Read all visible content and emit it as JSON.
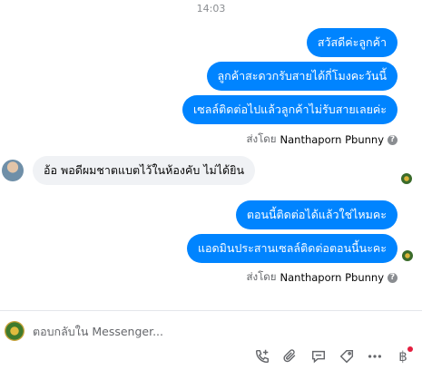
{
  "conversation": {
    "timestamp": "14:03",
    "messages_group_1": [
      "สวัสดีค่ะลูกค้า",
      "ลูกค้าสะดวกรับสายได้กี่โมงคะวันนี้",
      "เซลล์ติดต่อไปแล้วลูกค้าไม่รับสายเลยค่ะ"
    ],
    "sent_by_1": {
      "prefix": "ส่งโดย",
      "name": "Nanthaporn Pbunny"
    },
    "incoming_message": "อ้อ พอดีผมชาตแบตไว้ในห้องคับ ไม่ได้ยิน",
    "messages_group_2": [
      "ตอนนี้ติดต่อได้แล้วใช่ไหมคะ",
      "แอดมินประสานเซลล์ติดต่อตอนนี้นะคะ"
    ],
    "sent_by_2": {
      "prefix": "ส่งโดย",
      "name": "Nanthaporn Pbunny"
    }
  },
  "composer": {
    "placeholder": "ตอบกลับใน Messenger..."
  },
  "toolbar": {
    "icons": [
      "phone-plus-icon",
      "paperclip-icon",
      "saved-reply-icon",
      "tag-icon",
      "dots-icon",
      "baht-icon",
      "thumbs-up-icon"
    ],
    "baht_symbol": "฿"
  },
  "colors": {
    "outgoing_bubble": "#0084ff",
    "incoming_bubble": "#f0f2f5",
    "like_button": "#0084ff",
    "notification_dot": "#e41e3f"
  }
}
